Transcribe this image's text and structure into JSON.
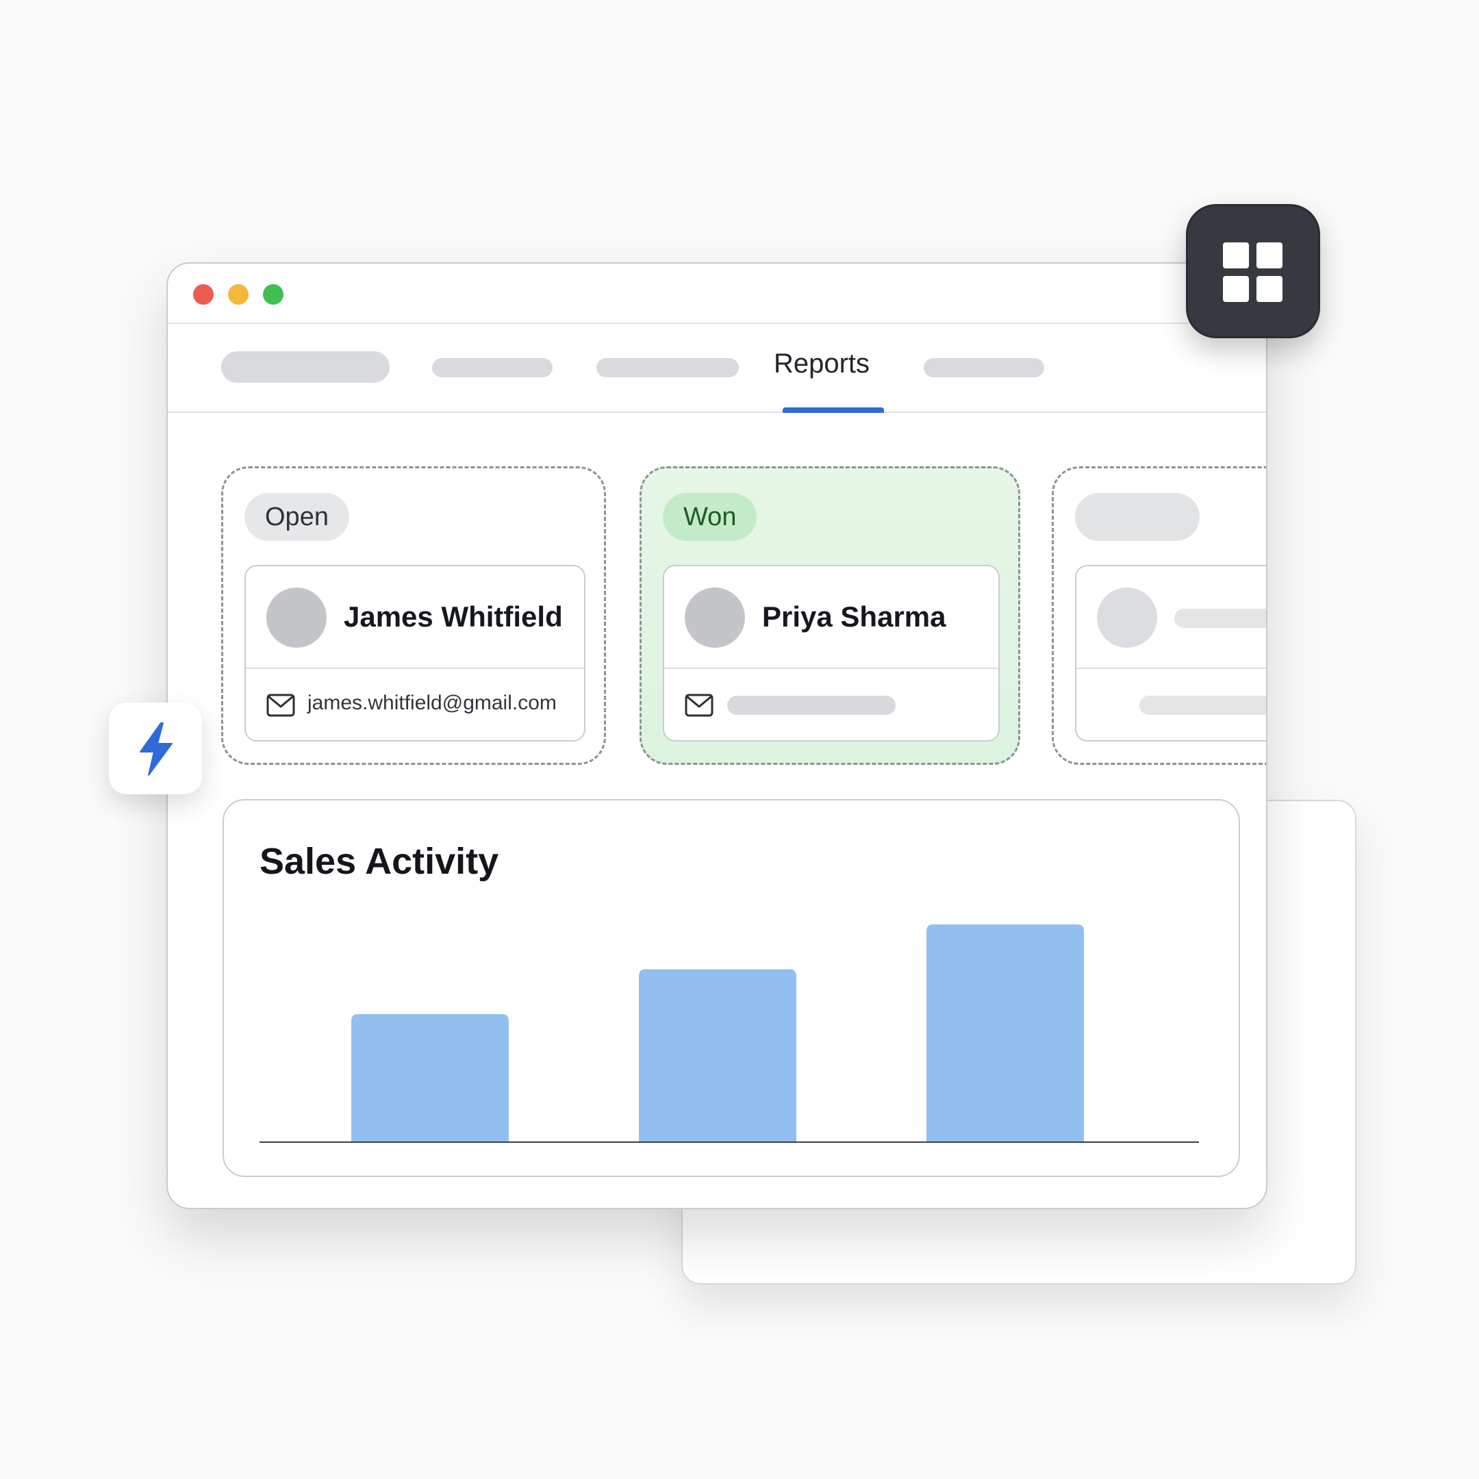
{
  "nav": {
    "active_tab": "Reports"
  },
  "columns": [
    {
      "status": "Open",
      "lead": {
        "name": "James Whitfield",
        "email": "james.whitfield@gmail.com"
      }
    },
    {
      "status": "Won",
      "lead": {
        "name": "Priya Sharma",
        "email": ""
      }
    }
  ],
  "chart_data": {
    "type": "bar",
    "title": "Sales Activity",
    "categories": [],
    "values": [
      1.0,
      1.35,
      1.7
    ],
    "colors": {
      "bar": "#91c0f0",
      "axis": "#3a3d44"
    }
  },
  "icons": {
    "traffic_lights": [
      "window-close-dot",
      "window-minimize-dot",
      "window-maximize-dot"
    ],
    "floating_left": "lightning-bolt-icon",
    "floating_right": "dashboard-grid-icon",
    "email": "envelope-icon"
  },
  "colors": {
    "accent": "#2f6bd8",
    "won_background": "#e1f4e3",
    "won_pill": "#c4ebc8",
    "open_pill": "#e6e7e9",
    "bolt": "#2f6bd8",
    "grid_tile": "#363a40"
  }
}
